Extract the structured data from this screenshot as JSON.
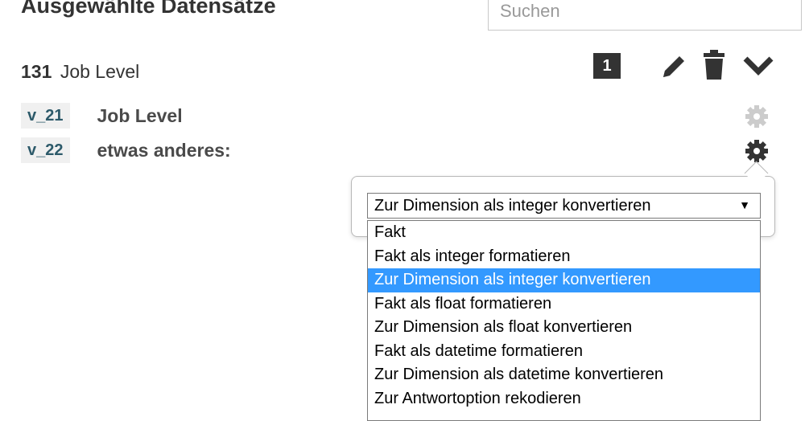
{
  "header": {
    "title": "Ausgewählte Datensätze",
    "search_placeholder": "Suchen"
  },
  "record": {
    "id": "131",
    "name": "Job Level",
    "badge_count": "1"
  },
  "variables": [
    {
      "tag": "v_21",
      "label": "Job Level"
    },
    {
      "tag": "v_22",
      "label": "etwas anderes:"
    }
  ],
  "popover": {
    "select_value": "Zur Dimension als integer konvertieren",
    "options": [
      "Fakt",
      "Fakt als integer formatieren",
      "Zur Dimension als integer konvertieren",
      "Fakt als float formatieren",
      "Zur Dimension als float konvertieren",
      "Fakt als datetime formatieren",
      "Zur Dimension als datetime konvertieren",
      "Zur Antwortoption rekodieren"
    ],
    "selected_index": 2
  },
  "colors": {
    "badge_bg": "#333333",
    "selected_option_bg": "#3399ff",
    "gear_inactive": "#cccccc",
    "gear_active": "#333333",
    "var_tag_bg": "#f0f0f0"
  },
  "icons": [
    "pencil-icon",
    "trash-icon",
    "chevron-down-icon",
    "gear-icon"
  ]
}
